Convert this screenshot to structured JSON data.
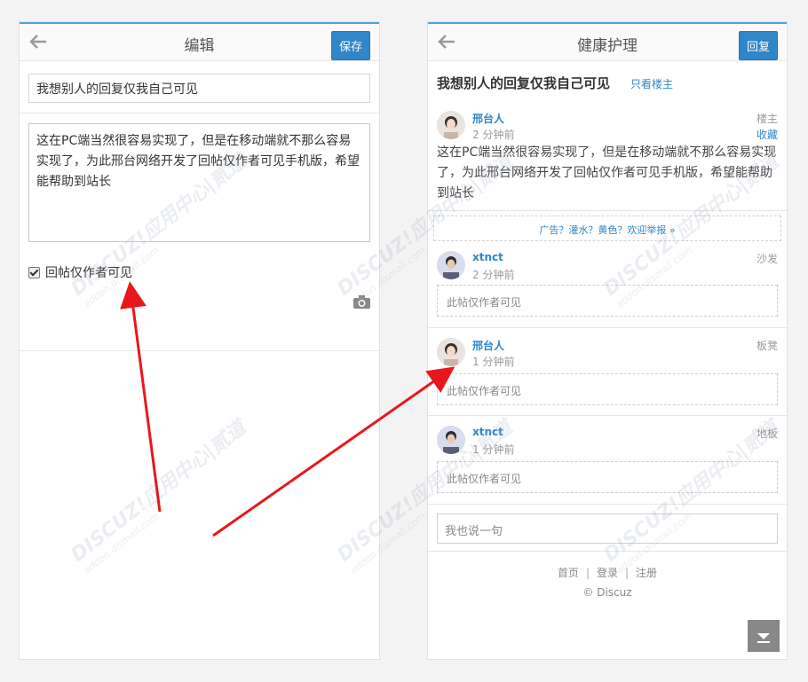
{
  "left": {
    "header": {
      "title": "编辑",
      "save_label": "保存"
    },
    "subject_value": "我想别人的回复仅我自己可见",
    "message_value": "这在PC端当然很容易实现了，但是在移动端就不那么容易实现了，为此邢台网络开发了回帖仅作者可见手机版，希望能帮助到站长",
    "checkbox_label": "回帖仅作者可见",
    "camera_icon": "camera-icon"
  },
  "right": {
    "header": {
      "title": "健康护理",
      "reply_label": "回复"
    },
    "thread_title": "我想别人的回复仅我自己可见",
    "only_op_label": "只看楼主",
    "op_post": {
      "author": "邢台人",
      "time": "2 分钟前",
      "floor": "楼主",
      "favorite": "收藏",
      "content": "这在PC端当然很容易实现了，但是在移动端就不那么容易实现了，为此邢台网络开发了回帖仅作者可见手机版，希望能帮助到站长"
    },
    "ad_text": "广告？灌水？黄色？欢迎举报 »",
    "replies": [
      {
        "author": "xtnct",
        "time": "2 分钟前",
        "floor": "沙发",
        "hidden_text": "此帖仅作者可见"
      },
      {
        "author": "邢台人",
        "time": "1 分钟前",
        "floor": "板凳",
        "hidden_text": "此帖仅作者可见"
      },
      {
        "author": "xtnct",
        "time": "1 分钟前",
        "floor": "地板",
        "hidden_text": "此帖仅作者可见"
      }
    ],
    "reply_placeholder": "我也说一句",
    "footer": {
      "home": "首页",
      "login": "登录",
      "register": "注册",
      "copyright": "© Discuz"
    }
  },
  "watermark": {
    "brand": "DISCUZ!应用中心|贰道",
    "url": "addon.dismall.com"
  },
  "colors": {
    "accent": "#2f86c9",
    "arrow": "#e8171b",
    "topbar_line": "#4fa3d8"
  }
}
